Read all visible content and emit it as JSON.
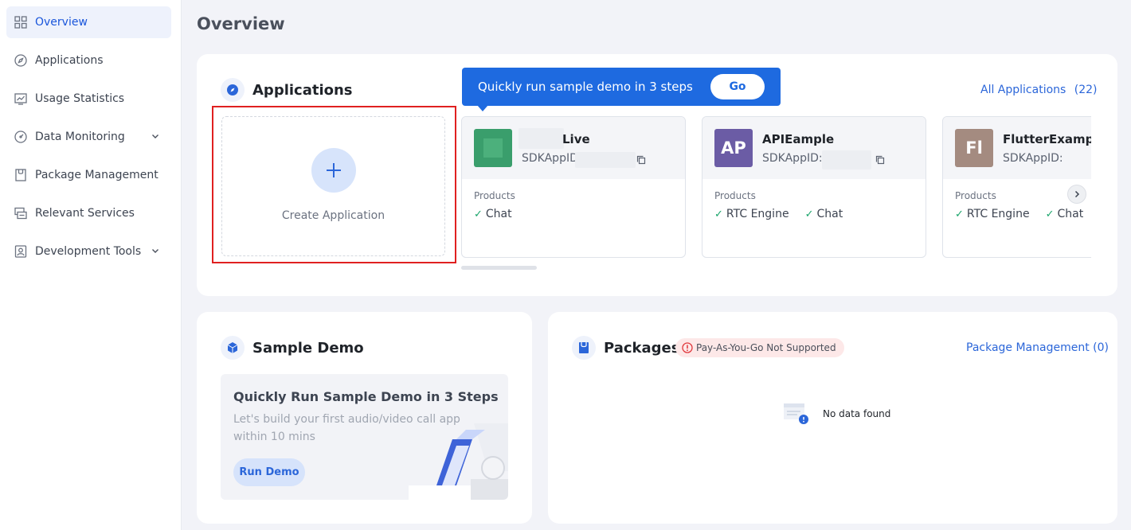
{
  "page_title": "Overview",
  "sidebar": {
    "items": [
      {
        "label": "Overview",
        "icon": "grid-icon",
        "active": true
      },
      {
        "label": "Applications",
        "icon": "compass-icon"
      },
      {
        "label": "Usage Statistics",
        "icon": "chart-icon"
      },
      {
        "label": "Data Monitoring",
        "icon": "gauge-icon",
        "expandable": true
      },
      {
        "label": "Package Management",
        "icon": "package-icon"
      },
      {
        "label": "Relevant Services",
        "icon": "services-icon"
      },
      {
        "label": "Development Tools",
        "icon": "tools-icon",
        "expandable": true
      }
    ]
  },
  "applications": {
    "title": "Applications",
    "all_link": "All Applications",
    "all_count": "(22)",
    "create_label": "Create Application",
    "create_icon": "plus-icon",
    "cards": [
      {
        "name": "Live",
        "avatar_text": "",
        "avatar_color": "#3a9e6c",
        "id_label": "SDKAppID",
        "products_label": "Products",
        "products": [
          "Chat"
        ]
      },
      {
        "name": "APIEample",
        "avatar_text": "AP",
        "avatar_color": "#6b5ca5",
        "id_label": "SDKAppID:",
        "products_label": "Products",
        "products": [
          "RTC Engine",
          "Chat"
        ]
      },
      {
        "name": "FlutterExample",
        "avatar_text": "Fl",
        "avatar_color": "#a48b80",
        "id_label": "SDKAppID:",
        "products_label": "Products",
        "products": [
          "RTC Engine",
          "Chat"
        ]
      }
    ]
  },
  "tooltip": {
    "text": "Quickly run sample demo in 3 steps",
    "button": "Go"
  },
  "sample_demo": {
    "title": "Sample Demo",
    "box_title": "Quickly Run Sample Demo in 3 Steps",
    "description": "Let's build your first audio/video call app within 10 mins",
    "button": "Run Demo"
  },
  "packages": {
    "title": "Packages",
    "badge": "Pay-As-You-Go Not Supported",
    "link": "Package Management (0)",
    "empty_text": "No data found"
  },
  "colors": {
    "accent": "#2b66d9",
    "tooltip": "#1e6ae0",
    "success": "#1aa56b",
    "highlight_frame": "#e02020"
  }
}
